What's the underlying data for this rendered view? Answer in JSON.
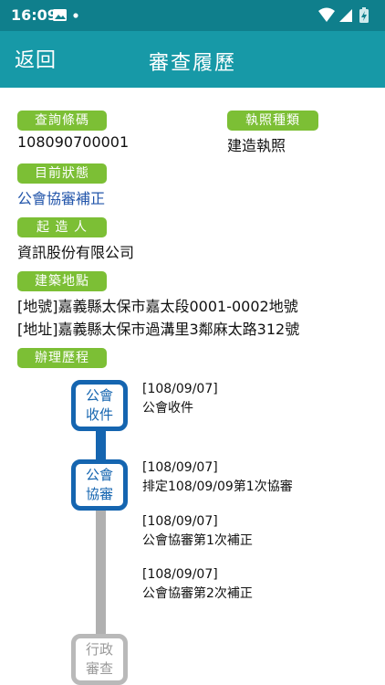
{
  "status_bar": {
    "time": "16:09",
    "icons_left": [
      "image-icon",
      "dot-icon"
    ],
    "icons_right": [
      "wifi-icon",
      "signal-icon",
      "battery-icon"
    ]
  },
  "app_bar": {
    "back_label": "返回",
    "title": "審查履歷"
  },
  "fields": {
    "query_code_label": "查詢條碼",
    "query_code_value": "108090700001",
    "license_type_label": "執照種類",
    "license_type_value": "建造執照",
    "current_status_label": "目前狀態",
    "current_status_value": "公會協審補正",
    "applicant_label": "起 造 人",
    "applicant_value": "資訊股份有限公司",
    "site_label": "建築地點",
    "site_lot": "[地號]嘉義縣太保市嘉太段0001-0002地號",
    "site_address": "[地址]嘉義縣太保市過溝里3鄰麻太路312號",
    "history_label": "辦理歷程"
  },
  "timeline": {
    "nodes": [
      {
        "line1": "公會",
        "line2": "收件",
        "state": "active"
      },
      {
        "line1": "公會",
        "line2": "協審",
        "state": "active"
      },
      {
        "line1": "行政",
        "line2": "審查",
        "state": "inactive"
      }
    ],
    "entries": [
      {
        "date": "[108/09/07]",
        "text": "公會收件"
      },
      {
        "date": "[108/09/07]",
        "text": "排定108/09/09第1次協審"
      },
      {
        "date": "[108/09/07]",
        "text": "公會協審第1次補正"
      },
      {
        "date": "[108/09/07]",
        "text": "公會協審第2次補正"
      }
    ]
  },
  "colors": {
    "status_bar": "#0f7f8c",
    "app_bar": "#1799a7",
    "label_pill": "#7cbf35",
    "node_active": "#1565b0",
    "node_inactive": "#b9b9b9",
    "status_value": "#2255aa"
  }
}
